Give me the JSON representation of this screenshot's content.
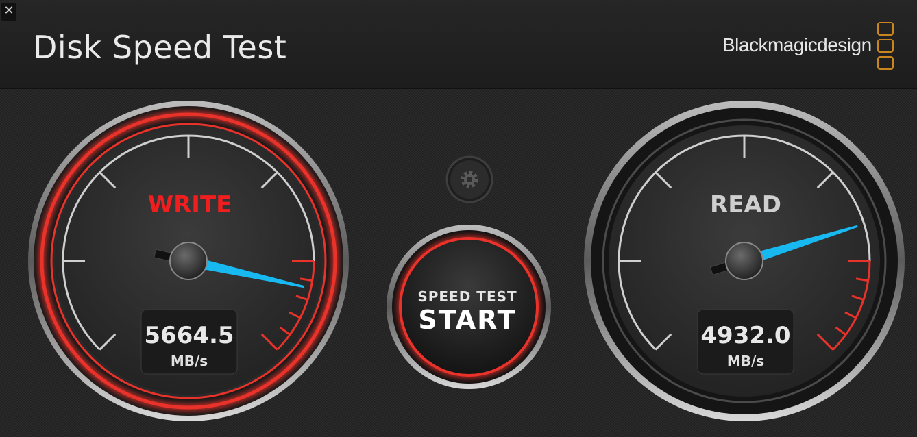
{
  "window": {
    "close_label": "✕"
  },
  "header": {
    "title": "Disk Speed Test",
    "brand": "Blackmagicdesign"
  },
  "write_gauge": {
    "label": "WRITE",
    "value": "5664.5",
    "unit": "MB/s",
    "needle_level": 0.88
  },
  "read_gauge": {
    "label": "READ",
    "value": "4932.0",
    "unit": "MB/s",
    "needle_level": 0.77
  },
  "start_button": {
    "line1": "SPEED TEST",
    "line2": "START"
  },
  "colors": {
    "accent_red": "#e8322a",
    "needle_blue": "#18b8f0",
    "logo_orange": "#c9851e"
  },
  "icons": {
    "settings": "gear-icon"
  }
}
